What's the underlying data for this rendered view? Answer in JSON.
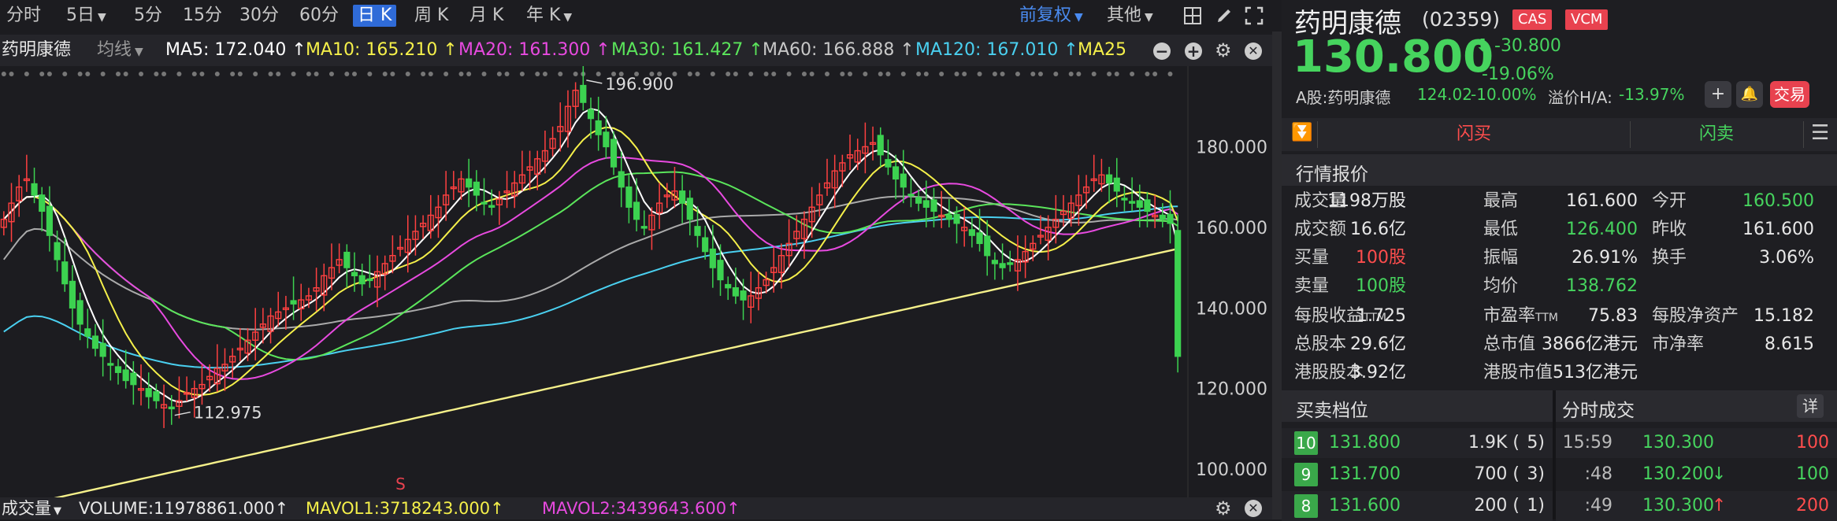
{
  "toolbar": {
    "periods": [
      {
        "label": "分时",
        "dd": false
      },
      {
        "label": "5日",
        "dd": true
      },
      {
        "label": "5分",
        "dd": false
      },
      {
        "label": "15分",
        "dd": false
      },
      {
        "label": "30分",
        "dd": false
      },
      {
        "label": "60分",
        "dd": false
      },
      {
        "label": "日 K",
        "dd": false,
        "active": true
      },
      {
        "label": "周 K",
        "dd": false
      },
      {
        "label": "月 K",
        "dd": false
      },
      {
        "label": "年 K",
        "dd": true
      }
    ],
    "adjust": "前复权",
    "other": "其他"
  },
  "ma_legend": {
    "name": "药明康德",
    "mode": "均线",
    "items": [
      {
        "text": "MA5: 172.040 ↑",
        "color": "#ffffff"
      },
      {
        "text": "MA10: 165.210 ↑",
        "color": "#f5f04a"
      },
      {
        "text": "MA20: 161.300 ↑",
        "color": "#e84ae0"
      },
      {
        "text": "MA30: 161.427 ↑",
        "color": "#5be55b"
      },
      {
        "text": "MA60: 166.888 ↑",
        "color": "#c8c8c8"
      },
      {
        "text": "MA120: 167.010 ↑",
        "color": "#4ad0f0"
      },
      {
        "text": "MA25",
        "color": "#f5f04a"
      }
    ]
  },
  "chart_data": {
    "type": "candlestick",
    "y_ticks": [
      "180.000",
      "160.000",
      "140.000",
      "120.000",
      "100.000"
    ],
    "ylim": [
      93,
      200
    ],
    "annotations": [
      {
        "text": "196.900",
        "kind": "high",
        "index": 76,
        "value": 196.9
      },
      {
        "text": "112.975",
        "kind": "low",
        "index": 22,
        "value": 112.975
      }
    ],
    "marker": {
      "text": "S",
      "index": 52
    },
    "ma_colors": {
      "ma5": "#ffffff",
      "ma10": "#f5f04a",
      "ma20": "#e84ae0",
      "ma30": "#5be55b",
      "ma60": "#aaaaaa",
      "ma120": "#4ad0f0",
      "ma250": "#f5f08a"
    },
    "bull_color": "#ff4040",
    "bear_color": "#3cd250",
    "close_series": [
      162,
      166,
      170,
      172,
      168,
      164,
      158,
      152,
      146,
      140,
      136,
      133,
      130,
      128,
      126,
      124,
      122,
      121,
      120,
      118,
      117,
      116,
      115,
      117,
      119,
      120,
      121,
      123,
      125,
      126,
      128,
      130,
      132,
      134,
      136,
      138,
      139,
      140,
      141,
      142,
      143,
      145,
      148,
      150,
      152,
      150,
      148,
      146,
      147,
      149,
      151,
      153,
      155,
      157,
      159,
      161,
      163,
      165,
      168,
      170,
      172,
      170,
      168,
      166,
      165,
      167,
      169,
      171,
      173,
      175,
      177,
      179,
      182,
      185,
      190,
      194,
      191,
      187,
      183,
      180,
      175,
      170,
      165,
      162,
      160,
      163,
      166,
      168,
      169,
      166,
      162,
      158,
      154,
      150,
      147,
      145,
      143,
      142,
      143,
      145,
      147,
      150,
      153,
      156,
      159,
      162,
      165,
      168,
      171,
      174,
      176,
      178,
      179,
      180,
      181,
      178,
      175,
      172,
      170,
      168,
      166,
      165,
      164,
      163,
      162,
      161,
      160,
      158,
      156,
      153,
      151,
      150,
      151,
      152,
      154,
      156,
      158,
      160,
      162,
      164,
      166,
      168,
      170,
      172,
      173,
      171,
      169,
      167,
      166,
      165,
      164,
      163,
      162,
      161,
      128
    ]
  },
  "volume_bar": {
    "label": "成交量",
    "volume": "VOLUME:11978861.000↑",
    "mavol1": "MAVOL1:3718243.000↑",
    "mavol2": "MAVOL2:3439643.600↑"
  },
  "quote": {
    "name": "药明康德",
    "code": "(02359)",
    "badges": [
      "CAS",
      "VCM"
    ],
    "price": "130.800",
    "change": "-30.800",
    "change_pct": "-19.06%",
    "a_share_label": "A股:药明康德",
    "a_share_price": "124.02",
    "a_share_pct": "-10.00%",
    "premium_label": "溢价H/A:",
    "premium_value": "-13.97%",
    "trade": "交易"
  },
  "flash": {
    "buy": "闪买",
    "sell": "闪卖"
  },
  "market": {
    "title": "行情报价",
    "rows": [
      [
        [
          "成交量",
          "1198万股",
          "n"
        ],
        [
          "最高",
          "161.600",
          "n"
        ],
        [
          "今开",
          "160.500",
          "g"
        ]
      ],
      [
        [
          "成交额",
          "16.6亿",
          "n"
        ],
        [
          "最低",
          "126.400",
          "g"
        ],
        [
          "昨收",
          "161.600",
          "n"
        ]
      ],
      [
        [
          "买量",
          "100股",
          "r"
        ],
        [
          "振幅",
          "26.91%",
          "n"
        ],
        [
          "换手",
          "3.06%",
          "n"
        ]
      ],
      [
        [
          "卖量",
          "100股",
          "g"
        ],
        [
          "均价",
          "138.762",
          "g"
        ],
        [
          "",
          "",
          ""
        ]
      ]
    ],
    "rows2": [
      [
        [
          "每股收益",
          "TTM",
          "1.725"
        ],
        [
          "市盈率",
          "TTM",
          "75.83"
        ],
        [
          "每股净资产",
          "",
          "15.182"
        ]
      ],
      [
        [
          "总股本",
          "",
          "29.6亿"
        ],
        [
          "总市值",
          "",
          "3866亿港元"
        ],
        [
          "市净率",
          "",
          "8.615"
        ]
      ],
      [
        [
          "港股股本",
          "",
          "3.92亿"
        ],
        [
          "港股市值",
          "",
          "513亿港元"
        ],
        [
          "",
          "",
          ""
        ]
      ]
    ]
  },
  "order_book": {
    "title": "买卖档位",
    "levels": [
      {
        "lvl": "10",
        "price": "131.800",
        "vol": "1.9K (",
        "cnt": "5)"
      },
      {
        "lvl": "9",
        "price": "131.700",
        "vol": "700 (",
        "cnt": "3)"
      },
      {
        "lvl": "8",
        "price": "131.600",
        "vol": "200 (",
        "cnt": "1)"
      }
    ]
  },
  "ticks": {
    "title": "分时成交",
    "detail": "详",
    "rows": [
      {
        "time": "15:59",
        "price": "130.300",
        "arrow": "",
        "vol": "100",
        "vc": "r"
      },
      {
        "time": ":48",
        "price": "130.200",
        "arrow": "↓",
        "vol": "100",
        "vc": "g"
      },
      {
        "time": ":49",
        "price": "130.300",
        "arrow": "↑",
        "vol": "200",
        "vc": "r"
      }
    ]
  }
}
